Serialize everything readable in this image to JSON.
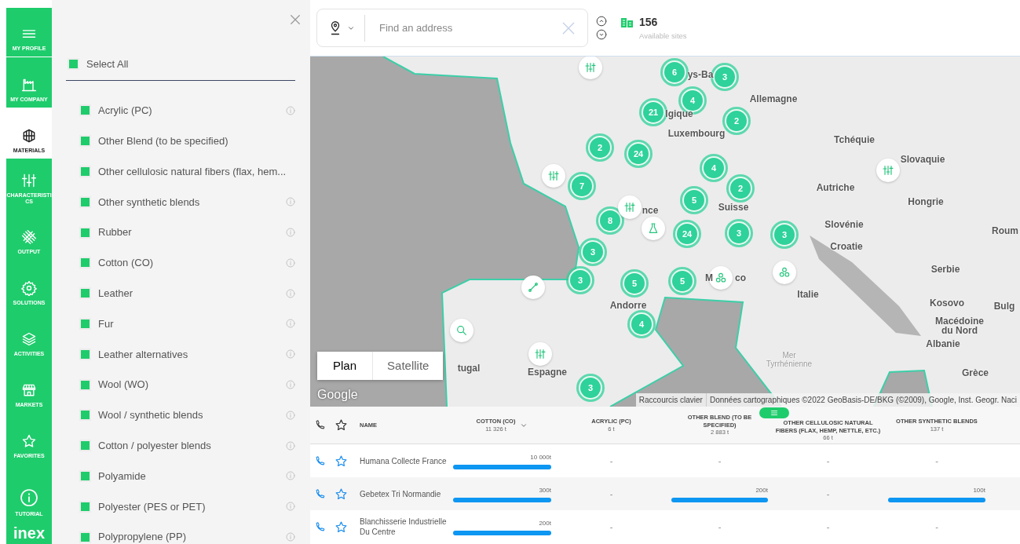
{
  "rail": {
    "items": [
      {
        "label": "MY PROFILE",
        "kind": "menu",
        "selected": false
      },
      {
        "label": "MY COMPANY",
        "kind": "factory",
        "selected": false
      },
      {
        "label": "MATERIALS",
        "kind": "cube",
        "selected": true
      },
      {
        "label": "CHARACTERISTICS",
        "kind": "sliders",
        "selected": false
      },
      {
        "label": "OUTPUT",
        "kind": "knot",
        "selected": false
      },
      {
        "label": "SOLUTIONS",
        "kind": "gear",
        "selected": false
      },
      {
        "label": "ACTIVITIES",
        "kind": "layers",
        "selected": false
      },
      {
        "label": "MARKETS",
        "kind": "shop",
        "selected": false
      },
      {
        "label": "FAVORITES",
        "kind": "star",
        "selected": false
      },
      {
        "label": "TUTORIAL",
        "kind": "info",
        "selected": false
      }
    ],
    "logo": "inex"
  },
  "panel": {
    "select_all": {
      "label": "Select All",
      "checked": true
    },
    "materials": [
      {
        "label": "Acrylic (PC)",
        "checked": true,
        "info": true
      },
      {
        "label": "Other Blend (to be specified)",
        "checked": true,
        "info": false
      },
      {
        "label": "Other cellulosic natural fibers (flax, hem...",
        "checked": true,
        "info": false
      },
      {
        "label": "Other synthetic blends",
        "checked": true,
        "info": true
      },
      {
        "label": "Rubber",
        "checked": true,
        "info": true
      },
      {
        "label": "Cotton (CO)",
        "checked": true,
        "info": true
      },
      {
        "label": "Leather",
        "checked": true,
        "info": true
      },
      {
        "label": "Fur",
        "checked": true,
        "info": true
      },
      {
        "label": "Leather alternatives",
        "checked": true,
        "info": true
      },
      {
        "label": "Wool (WO)",
        "checked": true,
        "info": true
      },
      {
        "label": "Wool / synthetic blends",
        "checked": true,
        "info": true
      },
      {
        "label": "Cotton / polyester blends",
        "checked": true,
        "info": true
      },
      {
        "label": "Polyamide",
        "checked": true,
        "info": true
      },
      {
        "label": "Polyester (PES or PET)",
        "checked": true,
        "info": true
      },
      {
        "label": "Polypropylene (PP)",
        "checked": true,
        "info": true
      }
    ]
  },
  "search": {
    "placeholder": "Find an address"
  },
  "sites": {
    "count": "156",
    "label": "Available sites"
  },
  "map": {
    "labels": [
      "ys-Ba",
      "Allemagne",
      "lgique",
      "Luxembourg",
      "Tchéquie",
      "Slovaquie",
      "Autriche",
      "Hongrie",
      "nce",
      "Suisse",
      "Slovénie",
      "Roum",
      "Croatie",
      "Serbie",
      "M",
      "co",
      "Italie",
      "Andorre",
      "Kosovo",
      "Bulg",
      "Macédoine",
      "du Nord",
      "Albanie",
      "tugal",
      "Espagne",
      "Grèce",
      "Mer",
      "Tyrrhénienne"
    ],
    "clusters": [
      "6",
      "3",
      "4",
      "21",
      "2",
      "2",
      "24",
      "4",
      "7",
      "2",
      "5",
      "8",
      "24",
      "3",
      "3",
      "3",
      "3",
      "5",
      "5",
      "4",
      "3"
    ],
    "pins": [
      {
        "kind": "sliders"
      },
      {
        "kind": "sliders"
      },
      {
        "kind": "sliders"
      },
      {
        "kind": "flask"
      },
      {
        "kind": "clover"
      },
      {
        "kind": "clover"
      },
      {
        "kind": "line"
      },
      {
        "kind": "search"
      },
      {
        "kind": "sliders"
      },
      {
        "kind": "sliders"
      }
    ],
    "map_types": [
      {
        "label": "Plan",
        "selected": true
      },
      {
        "label": "Satellite",
        "selected": false
      }
    ],
    "logo": "Google",
    "attribution": [
      "Raccourcis clavier",
      "Données cartographiques ©2022 GeoBasis-DE/BKG (©2009), Google, Inst. Geogr. Naci"
    ]
  },
  "table": {
    "columns": [
      {
        "label": "NAME",
        "sorted": false
      },
      {
        "label": "COTTON (CO)",
        "total": "11 326 t",
        "sorted": true
      },
      {
        "label": "ACRYLIC (PC)",
        "total": "6 t",
        "sorted": false
      },
      {
        "label": "OTHER BLEND (TO BE SPECIFIED)",
        "total": "2 883 t",
        "sorted": false
      },
      {
        "label": "OTHER CELLULOSIC NATURAL FIBERS (FLAX, HEMP, NETTLE, ETC.)",
        "total": "66 t",
        "sorted": false
      },
      {
        "label": "OTHER SYNTHETIC BLENDS",
        "total": "137 t",
        "sorted": false
      }
    ],
    "rows": [
      {
        "cells": [
          {
            "value": "Humana Collecte France"
          },
          {
            "value": "10 000t",
            "level": 1
          },
          {
            "value": "-"
          },
          {
            "value": "-"
          },
          {
            "value": "-"
          },
          {
            "value": "-"
          }
        ]
      },
      {
        "cells": [
          {
            "value": "Gebetex Tri Normandie"
          },
          {
            "value": "300t",
            "level": 1
          },
          {
            "value": "-"
          },
          {
            "value": "200t",
            "level": 1
          },
          {
            "value": "-"
          },
          {
            "value": "100t",
            "level": 1
          }
        ]
      },
      {
        "cells": [
          {
            "value": "Blanchisserie Industrielle Du Centre"
          },
          {
            "value": "200t",
            "level": 1
          },
          {
            "value": "-"
          },
          {
            "value": "-"
          },
          {
            "value": "-"
          },
          {
            "value": "-"
          }
        ]
      }
    ]
  }
}
